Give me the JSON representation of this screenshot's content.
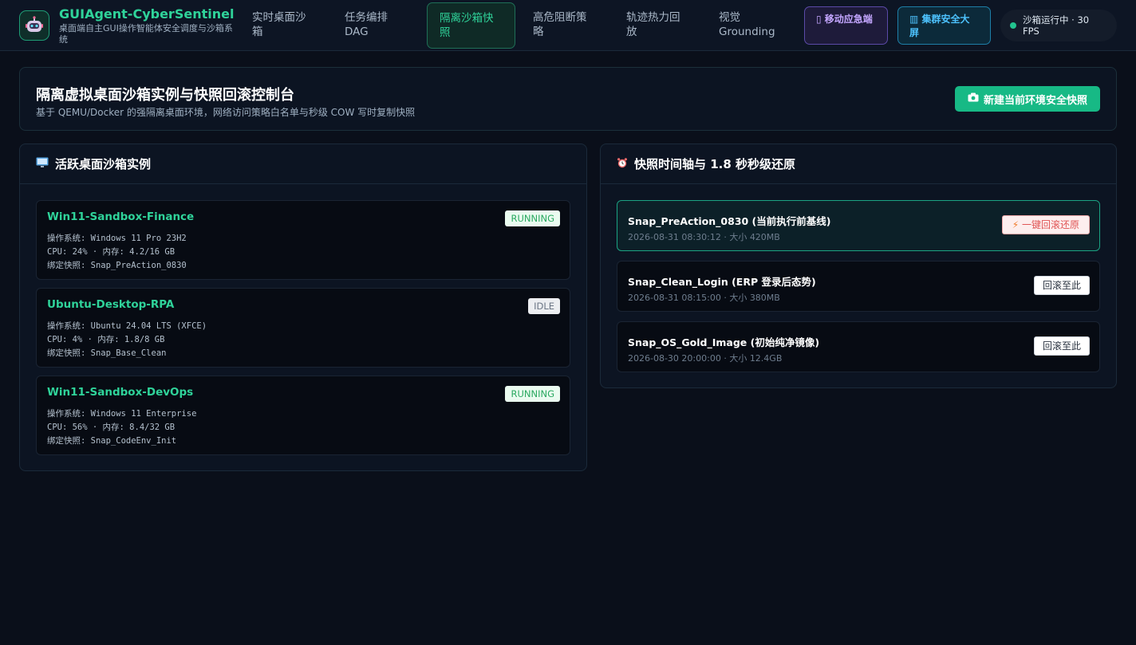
{
  "app": {
    "title": "GUIAgent-CyberSentinel",
    "subtitle": "桌面端自主GUI操作智能体安全调度与沙箱系统"
  },
  "nav": {
    "items": [
      {
        "label": "实时桌面沙箱",
        "active": false
      },
      {
        "label": "任务编排DAG",
        "active": false
      },
      {
        "label": "隔离沙箱快照",
        "active": true
      },
      {
        "label": "高危阻断策略",
        "active": false
      },
      {
        "label": "轨迹热力回放",
        "active": false
      },
      {
        "label": "视觉Grounding",
        "active": false
      }
    ]
  },
  "header_actions": {
    "mobile_label": "移动应急端",
    "screen_label": "集群安全大屏",
    "status_text": "沙箱运行中 · 30 FPS"
  },
  "banner": {
    "title": "隔离虚拟桌面沙箱实例与快照回滚控制台",
    "subtitle": "基于 QEMU/Docker 的强隔离桌面环境，网络访问策略白名单与秒级 COW 写时复制快照",
    "new_snapshot_label": "新建当前环境安全快照"
  },
  "sandboxes": {
    "title": "活跃桌面沙箱实例",
    "items": [
      {
        "name": "Win11-Sandbox-Finance",
        "status": "RUNNING",
        "os": "操作系统: Windows 11 Pro 23H2",
        "usage": "CPU: 24% · 内存: 4.2/16 GB",
        "snapshot": "绑定快照: Snap_PreAction_0830"
      },
      {
        "name": "Ubuntu-Desktop-RPA",
        "status": "IDLE",
        "os": "操作系统: Ubuntu 24.04 LTS (XFCE)",
        "usage": "CPU: 4% · 内存: 1.8/8 GB",
        "snapshot": "绑定快照: Snap_Base_Clean"
      },
      {
        "name": "Win11-Sandbox-DevOps",
        "status": "RUNNING",
        "os": "操作系统: Windows 11 Enterprise",
        "usage": "CPU: 56% · 内存: 8.4/32 GB",
        "snapshot": "绑定快照: Snap_CodeEnv_Init"
      }
    ]
  },
  "snapshots": {
    "title": "快照时间轴与 1.8 秒秒级还原",
    "items": [
      {
        "name": "Snap_PreAction_0830 (当前执行前基线)",
        "meta": "2026-08-31 08:30:12 · 大小 420MB",
        "action": "一键回滚还原",
        "current": true
      },
      {
        "name": "Snap_Clean_Login (ERP 登录后态势)",
        "meta": "2026-08-31 08:15:00 · 大小 380MB",
        "action": "回滚至此",
        "current": false
      },
      {
        "name": "Snap_OS_Gold_Image (初始纯净镜像)",
        "meta": "2026-08-30 20:00:00 · 大小 12.4GB",
        "action": "回滚至此",
        "current": false
      }
    ]
  },
  "colors": {
    "accent": "#2fd39a",
    "primary_button": "#17b985",
    "danger": "#e05555",
    "background": "#0a0f1a"
  }
}
